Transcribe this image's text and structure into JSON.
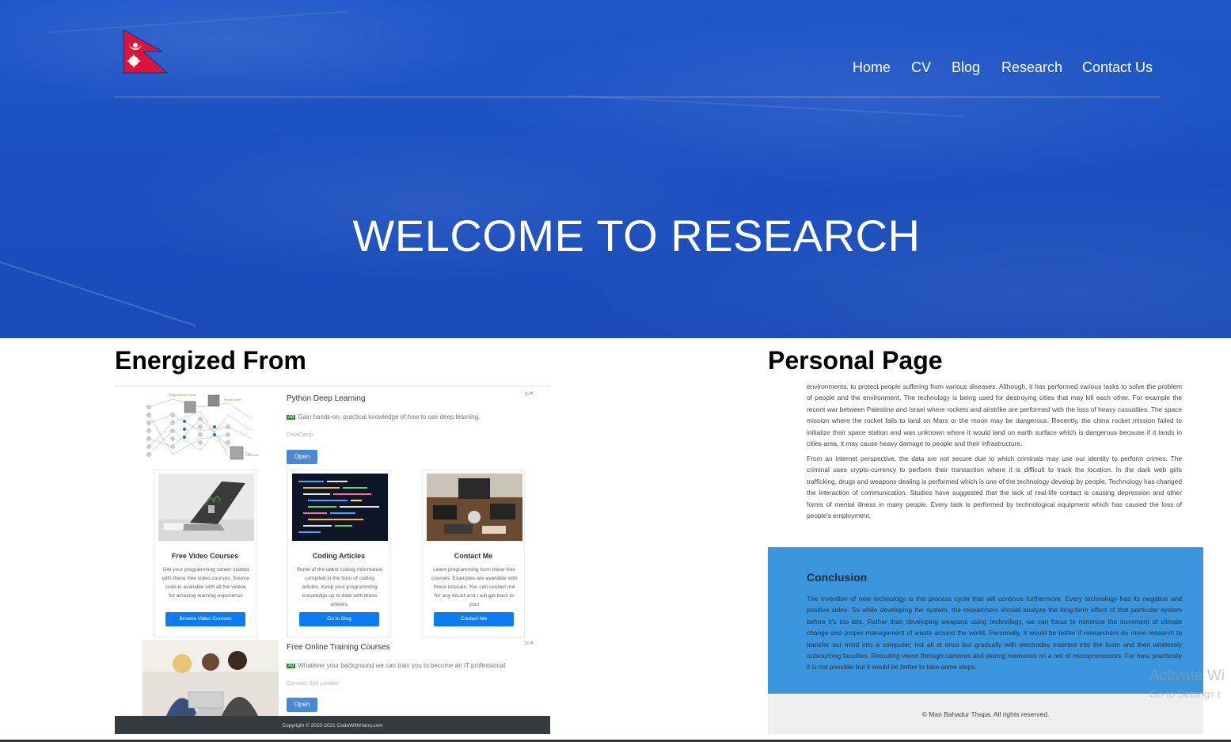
{
  "nav": {
    "items": [
      {
        "label": "Home"
      },
      {
        "label": "CV"
      },
      {
        "label": "Blog"
      },
      {
        "label": "Research"
      },
      {
        "label": "Contact Us"
      }
    ]
  },
  "hero": {
    "title": "WELCOME TO RESEARCH"
  },
  "left_section": {
    "title": "Energized From",
    "ad_top": {
      "title": "Python Deep Learning",
      "badge": "Ad",
      "desc": "Gain hands-on, practical knowledge of how to use deep learning.",
      "source": "DataCamp",
      "button": "Open",
      "illustration_labels": [
        "Diagonal Line Node",
        "Faces Node",
        "Cat Node"
      ]
    },
    "cards": [
      {
        "title": "Free Video Courses",
        "text": "Get your programming career started with these free video courses. Source code is available with all the videos for amazing learning experience",
        "button": "Browse Video Courses"
      },
      {
        "title": "Coding Articles",
        "text": "Some of the latest coding information compiled in the form of coding articles. Keep your programming knowledge up to date with these articles.",
        "button": "Go to Blog"
      },
      {
        "title": "Contact Me",
        "text": "Learn programming from these free courses. Examples are available with these tutorials. You can contact me for any doubt and I will get back to you!",
        "button": "Contact Me"
      }
    ],
    "ad_bottom": {
      "title": "Free Online Training Courses",
      "badge": "Ad",
      "desc": "Whatever your background we can train you to become an IT professional",
      "source": "Connect Soft Limited",
      "button": "Open"
    },
    "footer": "Copyright © 2020-2021 CodeWithHarry.com"
  },
  "right_section": {
    "title": "Personal Page",
    "para1": "environments. to protect people suffering from various diseases. Although, it has performed various tasks to solve the problem of people and the environment. The technology is being used for destroying cities that may kill each other. For example the recent war between Palestine and Israel where rockets and airstrike are performed with the loss of heavy casualties. The space mission where the rocket fails to land on Mars or the moon may be dangerous. Recently, the china rocket mission failed to initialize their space station and was unknown where it would land on earth surface which is dangerous because if it lands in cities area, it may cause heavy damage to people and their infrastructure.",
    "para2": "From an internet perspective, the data are not secure due to which criminals may use our identity to perform crimes. The criminal uses crypto-currency to perform their transaction where it is difficult to track the location. In the dark web girls trafficking, drugs and weapons dealing is performed which is one of the technology develop by people. Technology has changed the interaction of communication. Studies have suggested that the lack of real-life contact is causing depression and other forms of mental illness in many people. Every task is performed by technological equipment which has caused the loss of people's employment.",
    "conclusion_title": "Conclusion",
    "conclusion_text": "The invention of new technology is the process cycle that will continue furthermore. Every technology has its negative and positive sides. So while developing the system, the researchers should analyze the long-term effect of that particular system before it's too late. Rather than developing weapons using technology, we can focus to minimize the increment of climate change and proper management of waste around the world. Personally, it would be better if researchers do more research to transfer our mind into a computer, not all at once but gradually with electrodes inserted into the brain and then wirelessly outsourcing faculties. Rerouting vision through cameras and storing memories on a net of microprocessors. For now, practically it is not possible but it would be better to take some steps.",
    "footer": "© Man Bahadur Thapa. All rights reserved."
  },
  "watermark": {
    "line1": "Activate Wi",
    "line2": "Go to Settings t"
  },
  "colors": {
    "hero_blue": "#1b4fbf",
    "conclusion_blue": "#3a95dc",
    "flag_red": "#dc143c",
    "flag_border": "#003893",
    "button_blue": "#0d7bf2"
  }
}
